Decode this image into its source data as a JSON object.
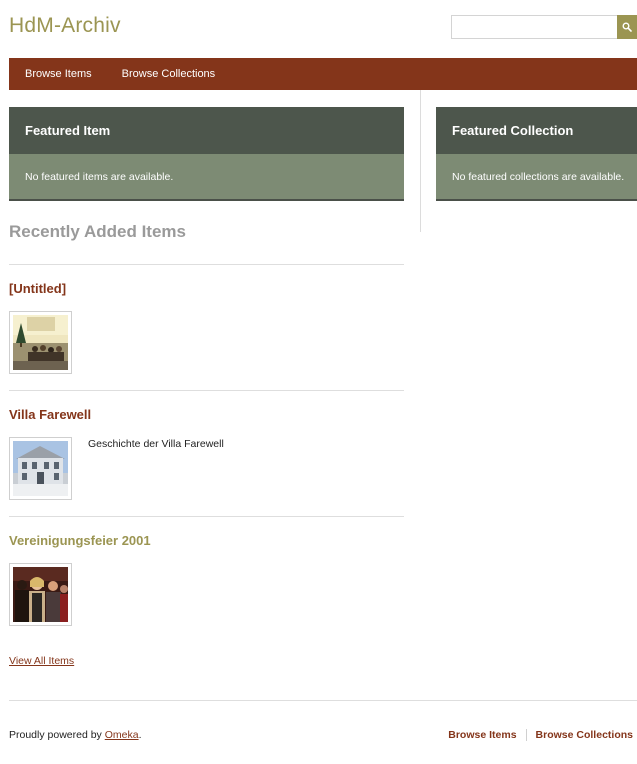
{
  "site": {
    "title": "HdM-Archiv"
  },
  "search": {
    "placeholder": "",
    "button": "search-icon"
  },
  "nav": {
    "items": [
      {
        "label": "Browse Items"
      },
      {
        "label": "Browse Collections"
      }
    ]
  },
  "featured_item": {
    "title": "Featured Item",
    "message": "No featured items are available."
  },
  "featured_collection": {
    "title": "Featured Collection",
    "message": "No featured collections are available."
  },
  "recent": {
    "title": "Recently Added Items",
    "items": [
      {
        "title": "[Untitled]",
        "description": ""
      },
      {
        "title": "Villa Farewell",
        "description": "Geschichte der Villa Farewell"
      },
      {
        "title": "Vereinigungsfeier 2001",
        "description": ""
      }
    ],
    "view_all": "View All Items"
  },
  "footer": {
    "powered_prefix": "Proudly powered by ",
    "powered_link": "Omeka",
    "powered_suffix": ".",
    "nav": [
      {
        "label": "Browse Items"
      },
      {
        "label": "Browse Collections"
      }
    ]
  },
  "colors": {
    "accent_olive": "#9b9552",
    "brand_red": "#84351a",
    "panel_dark": "#4d564c",
    "panel_light": "#7d8b74"
  }
}
